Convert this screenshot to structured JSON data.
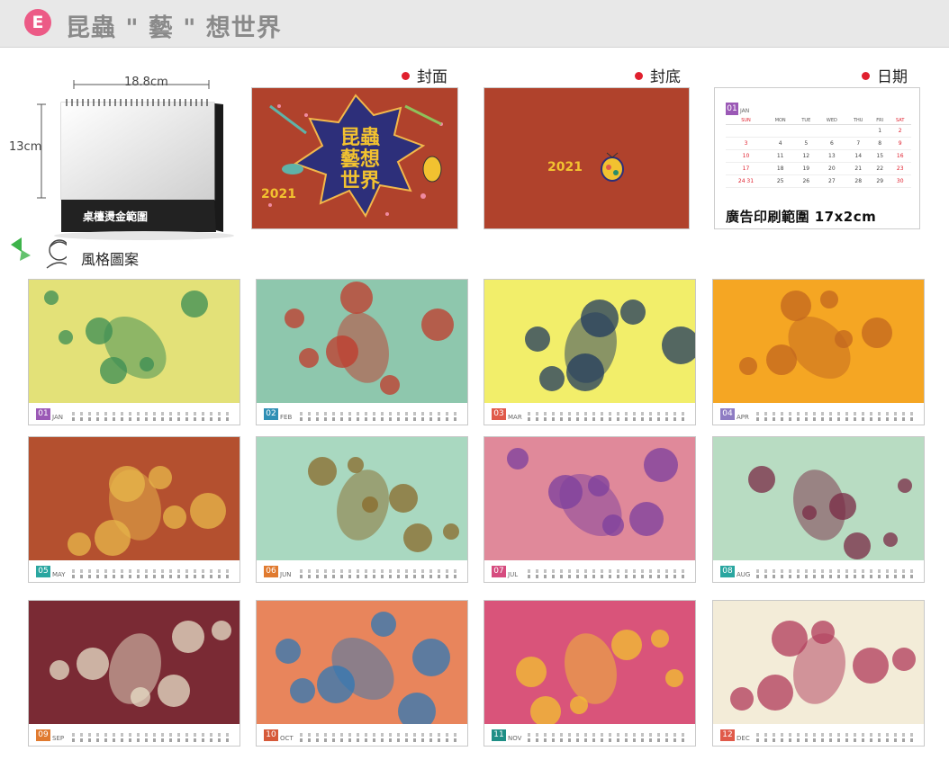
{
  "header": {
    "badge": "E",
    "title": "昆蟲 \" 藝 \" 想世界"
  },
  "mockup": {
    "width_label": "18.8cm",
    "height_label": "13cm",
    "base_text": "桌檯燙金範圍"
  },
  "sections": {
    "cover": "封面",
    "back": "封底",
    "date": "日期",
    "style": "風格圖案"
  },
  "cover": {
    "year": "2021",
    "title_chars": "昆蟲藝想世界"
  },
  "back_cover": {
    "year": "2021"
  },
  "date_panel": {
    "month_num": "01",
    "month_name": "JAN",
    "weekdays": [
      "SUN",
      "MON",
      "TUE",
      "WED",
      "THU",
      "FRI",
      "SAT"
    ],
    "weeks": [
      [
        "",
        "",
        "",
        "",
        "",
        "1",
        "2"
      ],
      [
        "3",
        "4",
        "5",
        "6",
        "7",
        "8",
        "9"
      ],
      [
        "10",
        "11",
        "12",
        "13",
        "14",
        "15",
        "16"
      ],
      [
        "17",
        "18",
        "19",
        "20",
        "21",
        "22",
        "23"
      ],
      [
        "24 31",
        "25",
        "26",
        "27",
        "28",
        "29",
        "30"
      ]
    ],
    "caption": "廣告印刷範圍 17x2cm"
  },
  "months": [
    {
      "num": "01",
      "name": "JAN",
      "color": "#9b59b6"
    },
    {
      "num": "02",
      "name": "FEB",
      "color": "#2f8fb5"
    },
    {
      "num": "03",
      "name": "MAR",
      "color": "#e05a4a"
    },
    {
      "num": "04",
      "name": "APR",
      "color": "#8e7cc3"
    },
    {
      "num": "05",
      "name": "MAY",
      "color": "#2aa6a0"
    },
    {
      "num": "06",
      "name": "JUN",
      "color": "#e07a2f"
    },
    {
      "num": "07",
      "name": "JUL",
      "color": "#d64c7f"
    },
    {
      "num": "08",
      "name": "AUG",
      "color": "#2aa6a0"
    },
    {
      "num": "09",
      "name": "SEP",
      "color": "#e07a2f"
    },
    {
      "num": "10",
      "name": "OCT",
      "color": "#d65a3a"
    },
    {
      "num": "11",
      "name": "NOV",
      "color": "#1f8f86"
    },
    {
      "num": "12",
      "name": "DEC",
      "color": "#e05a4a"
    }
  ],
  "colors": {
    "badge": "#ec5a86",
    "cover_bg": "#b0422c",
    "red_dot": "#e0202e",
    "jan_bg": "#e3e178",
    "feb_bg": "#8ec7ad",
    "mar_bg": "#f2ee6a",
    "apr_bg": "#f5a623",
    "may_bg": "#b4502f",
    "jun_bg": "#a9d8c0",
    "jul_bg": "#e0899a",
    "aug_bg": "#b8dcc2",
    "sep_bg": "#7a2a34",
    "oct_bg": "#e8855c",
    "nov_bg": "#d9547a",
    "dec_bg": "#f3ecd8"
  }
}
